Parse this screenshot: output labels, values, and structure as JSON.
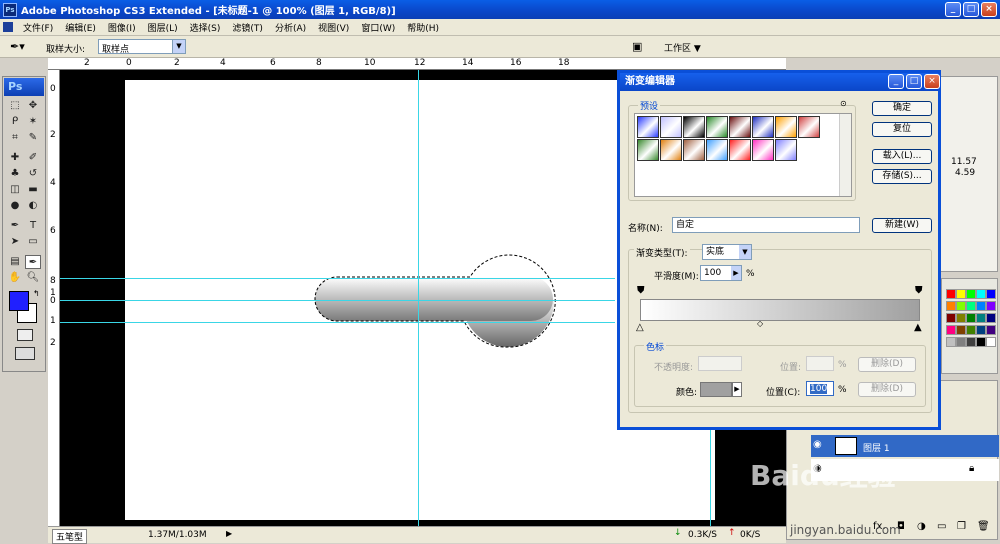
{
  "window": {
    "title": "Adobe Photoshop CS3 Extended - [未标题-1 @ 100% (图层 1, RGB/8)]",
    "logo_text": "Ps",
    "min_label": "_",
    "max_label": "□",
    "close_label": "×"
  },
  "menu": [
    "文件(F)",
    "编辑(E)",
    "图像(I)",
    "图层(L)",
    "选择(S)",
    "滤镜(T)",
    "分析(A)",
    "视图(V)",
    "窗口(W)",
    "帮助(H)"
  ],
  "options_bar": {
    "sample_size_label": "取样大小:",
    "sample_size_value": "取样点",
    "workspace_label": "工作区 ▼"
  },
  "toolbox": {
    "logo": "Ps"
  },
  "ruler_top_ticks": [
    "2",
    "0",
    "2",
    "4",
    "6",
    "8",
    "10",
    "12",
    "14",
    "16",
    "18"
  ],
  "ruler_left_ticks": [
    "0",
    "2",
    "4",
    "6",
    "8",
    "1",
    "0",
    "1",
    "2"
  ],
  "dialog": {
    "title": "渐变编辑器",
    "presets_label": "预设",
    "ok": "确定",
    "reset": "复位",
    "load": "载入(L)...",
    "save": "存储(S)...",
    "name_label": "名称(N):",
    "name_value": "自定",
    "new_button": "新建(W)",
    "gradient_type_label": "渐变类型(T):",
    "gradient_type_value": "实底",
    "smoothness_label": "平滑度(M):",
    "smoothness_value": "100",
    "percent": "%",
    "stops_label": "色标",
    "opacity_label": "不透明度:",
    "location_label": "位置:",
    "delete_label": "删除(D)",
    "color_label": "颜色:",
    "location_c_label": "位置(C):",
    "location_c_value": "100",
    "presets": [
      "#2a3cff",
      "#c0c0ff",
      "#000000",
      "#2a8a2a",
      "#6a1010",
      "#2030c0",
      "#ffa000",
      "#d04040",
      "#3a8a30",
      "#e08010",
      "#a06040",
      "#40a0ff",
      "#ff2020",
      "#ff30c0",
      "#8080ff"
    ]
  },
  "right_panel": {
    "value1": "11.57",
    "value2": "4.59",
    "layer_name": "图层 1"
  },
  "status": {
    "doc_size": "1.37M/1.03M",
    "ime": "五笔型",
    "net_down": "0.3K/S",
    "net_up": "0K/S"
  },
  "watermark": {
    "brand": "Baidu经验",
    "url": "jingyan.baidu.com"
  },
  "colors": {
    "foreground": "#2020ff",
    "background": "#ffffff",
    "accent": "#0a4fd8"
  }
}
